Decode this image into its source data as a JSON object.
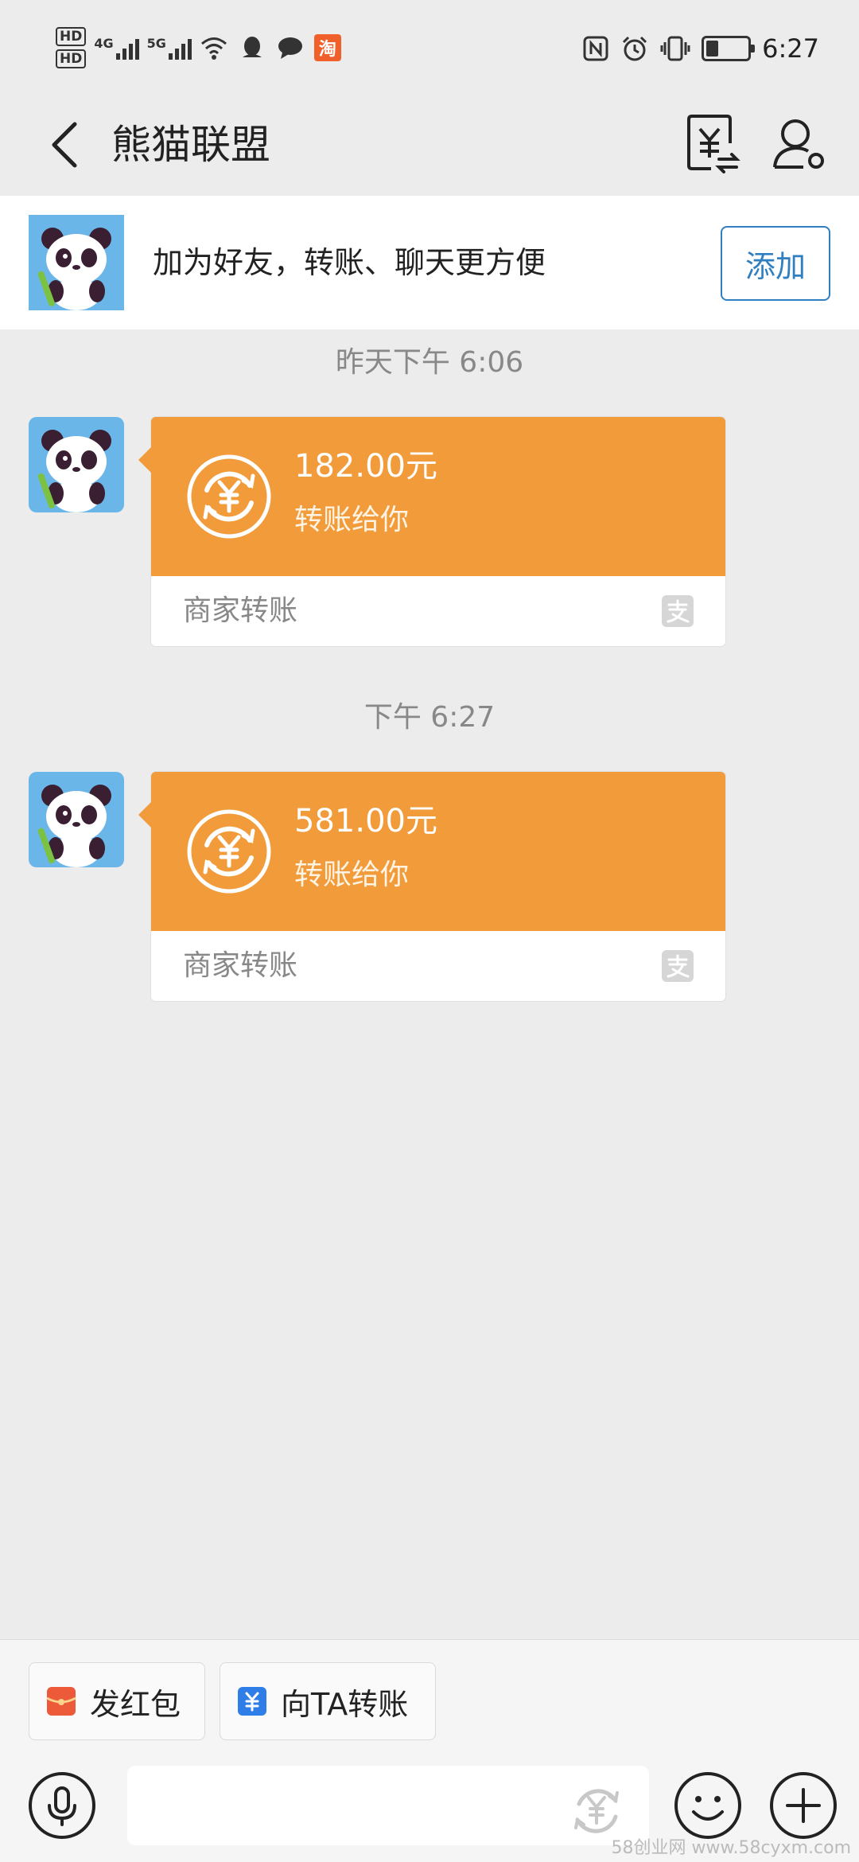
{
  "status_bar": {
    "hd1": "HD",
    "hd2": "HD",
    "net1": "4G",
    "net2": "5G",
    "taobao_glyph": "淘",
    "time": "6:27",
    "battery_level": 0.3,
    "icons": [
      "signal-icon",
      "wifi-icon",
      "qq-icon",
      "message-icon",
      "taobao-icon",
      "nfc-icon",
      "alarm-icon",
      "vibrate-icon",
      "battery-icon"
    ]
  },
  "header": {
    "title": "熊猫联盟",
    "icons": [
      "back-arrow-icon",
      "bill-icon",
      "profile-icon"
    ]
  },
  "banner": {
    "text": "加为好友，转账、聊天更方便",
    "add_label": "添加"
  },
  "messages": [
    {
      "timestamp": "昨天下午 6:06",
      "amount": "182.00元",
      "description": "转账给你",
      "footer": "商家转账"
    },
    {
      "timestamp": "下午 6:27",
      "amount": "581.00元",
      "description": "转账给你",
      "footer": "商家转账"
    }
  ],
  "bottom_bar": {
    "red_packet_label": "发红包",
    "transfer_label": "向TA转账",
    "input_value": "",
    "watermark": "58创业网 www.58cyxm.com"
  },
  "colors": {
    "card_orange": "#f19b3a",
    "link_blue": "#2f7fc1",
    "background": "#ececec"
  }
}
